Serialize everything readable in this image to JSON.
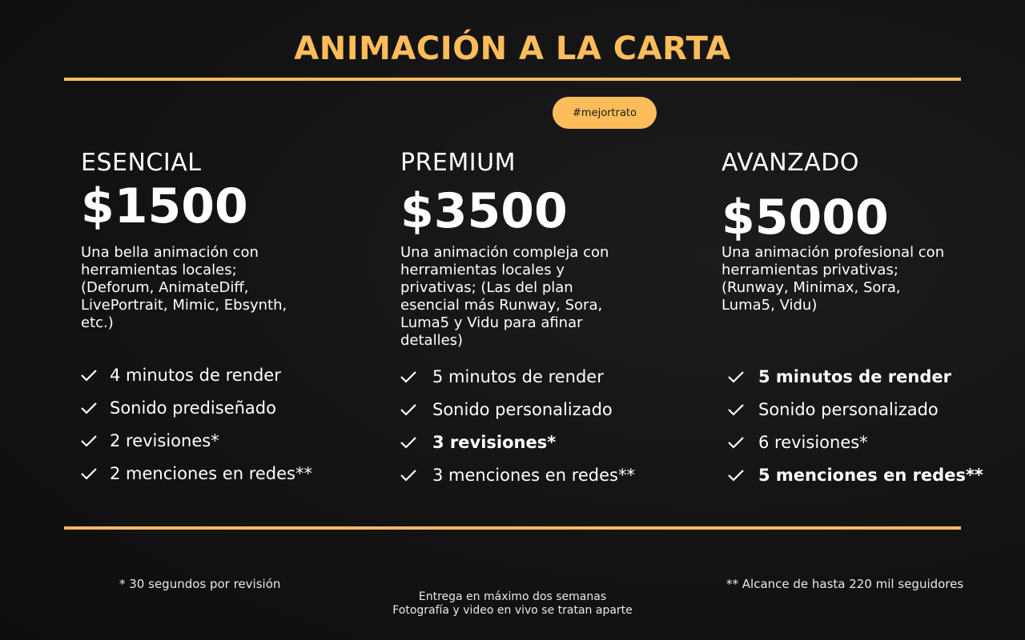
{
  "title": "ANIMACIÓN A LA CARTA",
  "badge": "#mejortrato",
  "plans": [
    {
      "name": "ESENCIAL",
      "price": "$1500",
      "description": "Una bella animación con herramientas locales; (Deforum, AnimateDiff, LivePortrait, Mimic, Ebsynth, etc.)",
      "features": [
        "4 minutos de render",
        "Sonido prediseñado",
        "2 revisiones*",
        "2 menciones en redes**"
      ]
    },
    {
      "name": "PREMIUM",
      "price": "$3500",
      "description": "Una animación compleja con herramientas locales y privativas; (Las del plan esencial más Runway, Sora, Luma5 y Vidu para afinar detalles)",
      "features": [
        "5 minutos de render",
        "Sonido personalizado",
        "3 revisiones*",
        "3 menciones en redes**"
      ]
    },
    {
      "name": "AVANZADO",
      "price": "$5000",
      "description": "Una animación profesional con herramientas privativas; (Runway, Minimax, Sora, Luma5, Vidu)",
      "features": [
        "5 minutos de render",
        "Sonido personalizado",
        "6 revisiones*",
        "5 menciones en redes**"
      ]
    }
  ],
  "footnotes": {
    "left": "* 30 segundos por revisión",
    "right": "** Alcance de hasta 220 mil seguidores",
    "center_line1": "Entrega en máximo dos semanas",
    "center_line2": "Fotografía y video en vivo se tratan aparte"
  },
  "colors": {
    "accent": "#fdbd5b",
    "background": "#141314",
    "text": "#ffffff"
  },
  "icons": {
    "feature_bullet": "check-icon"
  }
}
